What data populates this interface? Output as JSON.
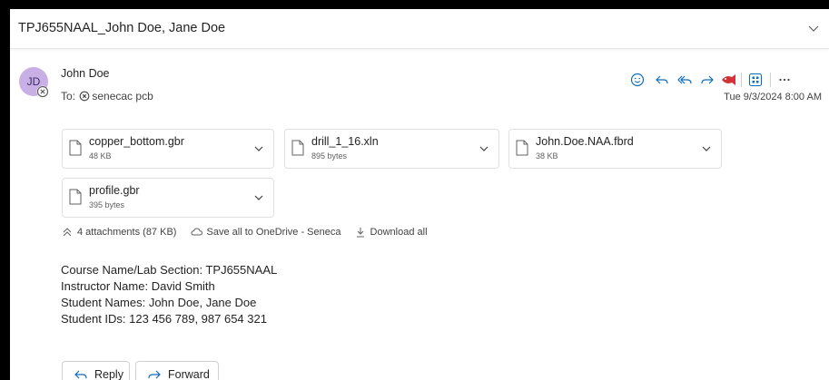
{
  "subject": "TPJ655NAAL_John Doe, Jane Doe",
  "sender": {
    "initials": "JD",
    "name": "John Doe",
    "to_label": "To:",
    "recipient": "senecac pcb",
    "timestamp": "Tue 9/3/2024 8:00 AM"
  },
  "actions": [
    "smiley-icon",
    "reply-icon",
    "reply-all-icon",
    "forward-icon",
    "fish-icon",
    "apps-icon",
    "more-icon"
  ],
  "attachments": [
    {
      "name": "copper_bottom.gbr",
      "size": "48 KB"
    },
    {
      "name": "drill_1_16.xln",
      "size": "895 bytes"
    },
    {
      "name": "John.Doe.NAA.fbrd",
      "size": "38 KB"
    },
    {
      "name": "profile.gbr",
      "size": "395 bytes"
    }
  ],
  "attachment_summary": {
    "count": "4 attachments (87 KB)",
    "save_all": "Save all to OneDrive - Seneca",
    "download_all": "Download all"
  },
  "body": {
    "line1": "Course Name/Lab Section: TPJ655NAAL",
    "line2": "Instructor Name: David Smith",
    "line3": "Student Names: John Doe, Jane Doe",
    "line4": "Student IDs: 123 456 789, 987 654 321"
  },
  "buttons": {
    "reply": "Reply",
    "forward": "Forward"
  },
  "colors": {
    "accent": "#0f6cbd",
    "avatar_bg": "#c8b0e6",
    "fish": "#d13438"
  }
}
